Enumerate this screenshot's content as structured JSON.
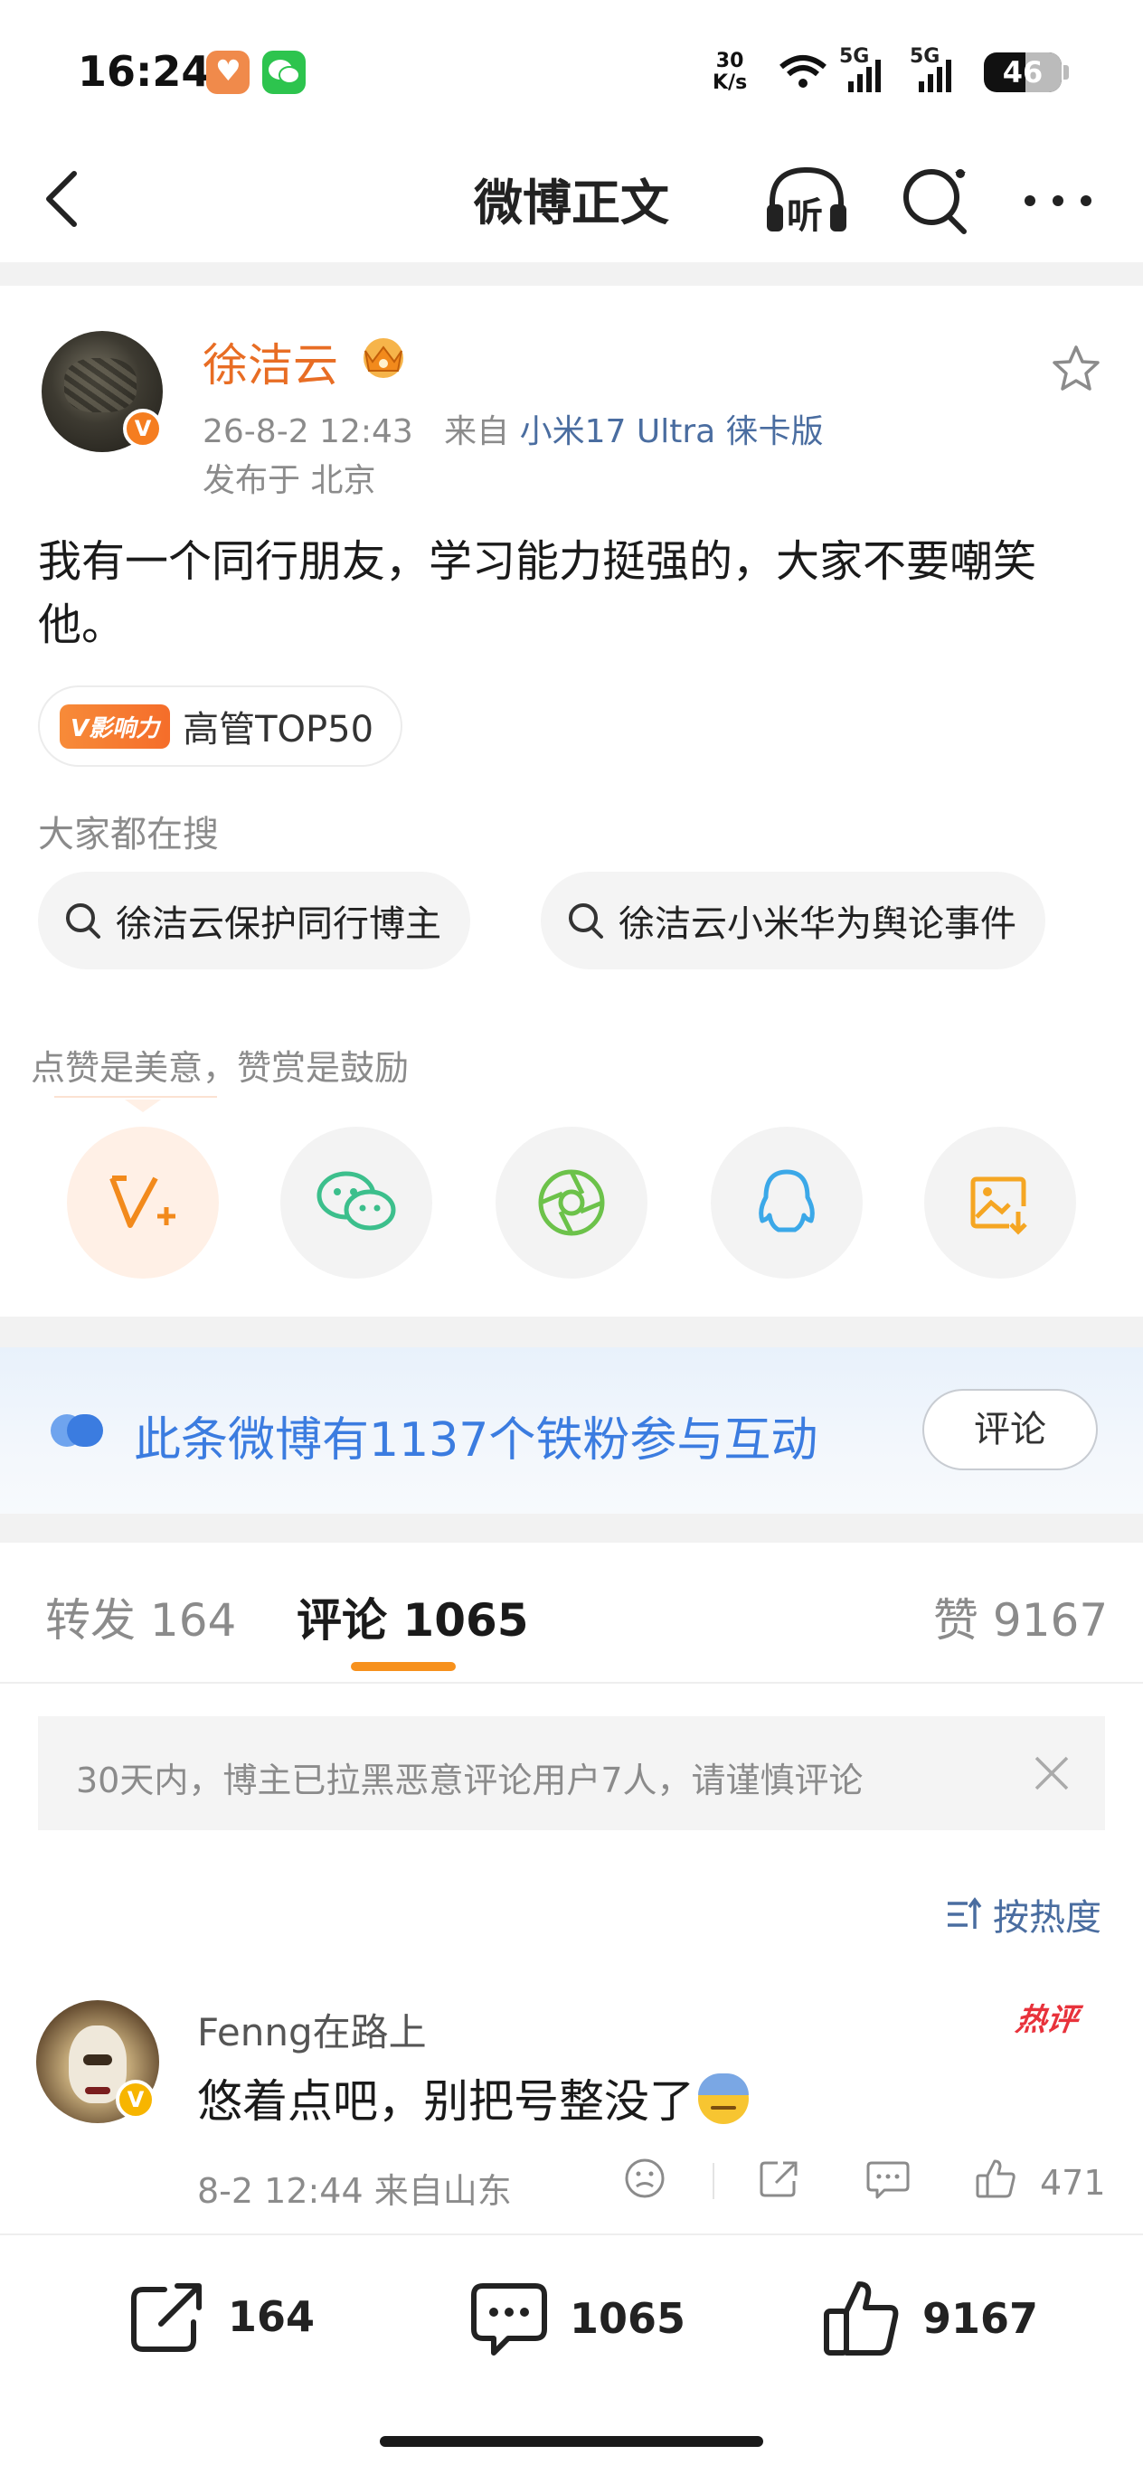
{
  "status_bar": {
    "time": "16:24",
    "net_speed_value": "30",
    "net_speed_unit": "K/s",
    "signal1": "5G",
    "signal2": "5G",
    "battery": "46"
  },
  "nav": {
    "title": "微博正文",
    "listen_label": "听"
  },
  "post": {
    "author": "徐洁云",
    "verified_mark": "V",
    "time": "26-8-2 12:43",
    "source_prefix": "来自",
    "source": "小米17 Ultra 徕卡版",
    "location": "发布于 北京",
    "text": "我有一个同行朋友，学习能力挺强的，大家不要嘲笑他。",
    "influence_badge": "V影响力",
    "influence_label": "高管TOP50"
  },
  "search": {
    "hint": "大家都在搜",
    "chips": [
      "徐洁云保护同行博主",
      "徐洁云小米华为舆论事件"
    ]
  },
  "reward": {
    "hint": "点赞是美意，赞赏是鼓励"
  },
  "share_icons": [
    "v-plus-icon",
    "wechat-icon",
    "moments-icon",
    "qq-icon",
    "save-image-icon"
  ],
  "fans_banner": {
    "text": "此条微博有1137个铁粉参与互动",
    "button": "评论",
    "accent": "#3b7ce0"
  },
  "tabs": {
    "repost": "转发 164",
    "comment": "评论 1065",
    "like": "赞 9167"
  },
  "notice": {
    "text": "30天内，博主已拉黑恶意评论用户7人，请谨慎评论"
  },
  "sort": {
    "label": "按热度"
  },
  "comment": {
    "user": "Fenng在路上",
    "hot_label": "热评",
    "text": "悠着点吧，别把号整没了",
    "meta": "8-2 12:44  来自山东",
    "likes": "471"
  },
  "bottom_bar": {
    "repost_count": "164",
    "comment_count": "1065",
    "like_count": "9167"
  },
  "colors": {
    "brand_orange": "#f7911d",
    "author_orange": "#e86d24",
    "link_blue": "#4a6da0",
    "hot_red": "#e8323b"
  }
}
